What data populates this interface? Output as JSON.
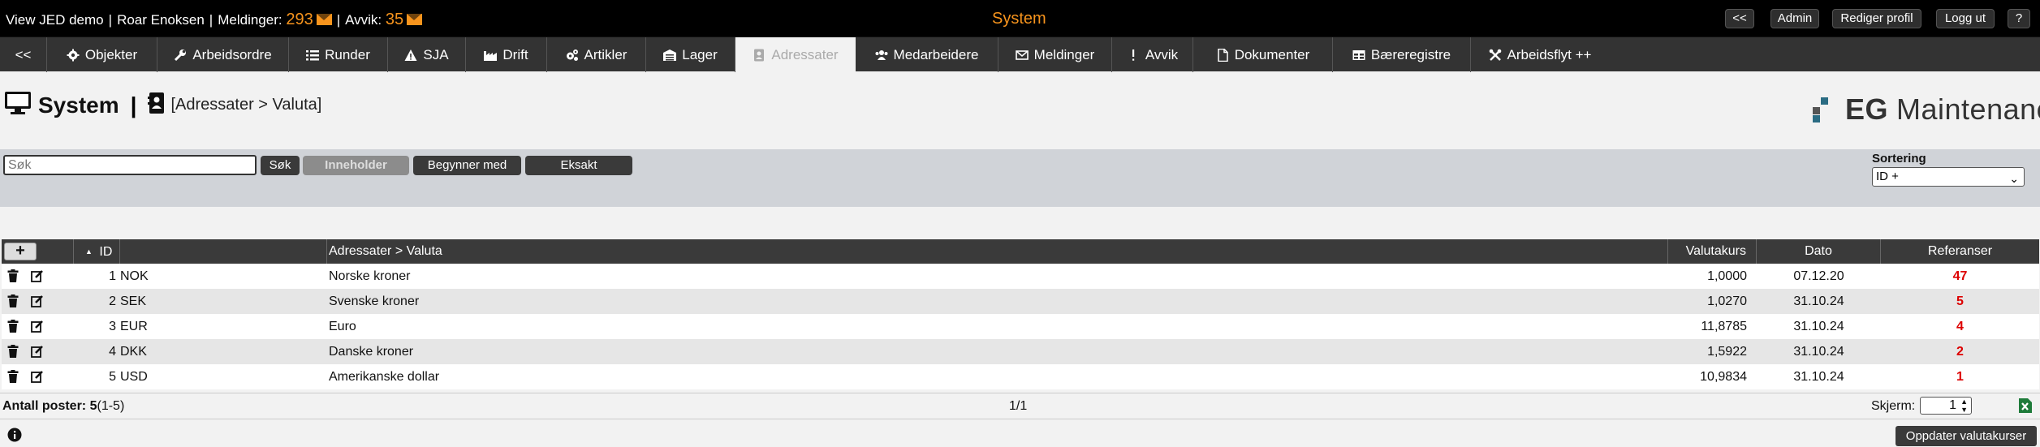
{
  "topbar": {
    "view_label": "View JED demo",
    "user": "Roar Enoksen",
    "messages_label": "Meldinger:",
    "messages_count": "293",
    "deviations_label": "Avvik:",
    "deviations_count": "35",
    "center_title": "System",
    "buttons": {
      "back": "<<",
      "admin": "Admin",
      "edit_profile": "Rediger profil",
      "logout": "Logg ut",
      "help": "?"
    }
  },
  "nav": {
    "collapse": "<<",
    "tabs": [
      "Objekter",
      "Arbeidsordre",
      "Runder",
      "SJA",
      "Drift",
      "Artikler",
      "Lager",
      "Adressater",
      "Medarbeidere",
      "Meldinger",
      "Avvik",
      "Dokumenter",
      "Bæreregistre",
      "Arbeidsflyt ++"
    ],
    "active": "Adressater"
  },
  "page": {
    "title": "System",
    "separator": "|",
    "breadcrumb": "[Adressater > Valuta]",
    "brand_bold": "EG",
    "brand_rest": "Maintenance"
  },
  "search": {
    "placeholder": "Søk",
    "search_button": "Søk",
    "contains_button": "Inneholder",
    "starts_with_button": "Begynner med",
    "exact_button": "Eksakt",
    "sort_label": "Sortering",
    "sort_value": "ID +",
    "colors": {
      "active_mode": "#8c8c8c",
      "mode": "#3a3a3a"
    }
  },
  "table": {
    "add_label": "+",
    "sort_arrow": "▲",
    "headers": {
      "id": "ID",
      "name": "Adressater > Valuta",
      "rate": "Valutakurs",
      "date": "Dato",
      "refs": "Referanser"
    },
    "rows": [
      {
        "id": "1",
        "code": "NOK",
        "name": "Norske kroner",
        "rate": "1,0000",
        "date": "07.12.20",
        "refs": "47"
      },
      {
        "id": "2",
        "code": "SEK",
        "name": "Svenske kroner",
        "rate": "1,0270",
        "date": "31.10.24",
        "refs": "5"
      },
      {
        "id": "3",
        "code": "EUR",
        "name": "Euro",
        "rate": "11,8785",
        "date": "31.10.24",
        "refs": "4"
      },
      {
        "id": "4",
        "code": "DKK",
        "name": "Danske kroner",
        "rate": "1,5922",
        "date": "31.10.24",
        "refs": "2"
      },
      {
        "id": "5",
        "code": "USD",
        "name": "Amerikanske dollar",
        "rate": "10,9834",
        "date": "31.10.24",
        "refs": "1"
      }
    ]
  },
  "footer": {
    "count_label": "Antall poster:",
    "count_value": "5",
    "count_range": "(1-5)",
    "page_indicator": "1/1",
    "screen_label": "Skjerm:",
    "screen_value": "1",
    "update_button": "Oppdater valutakurser",
    "info_icon": "info-icon",
    "excel_icon": "excel-icon"
  }
}
